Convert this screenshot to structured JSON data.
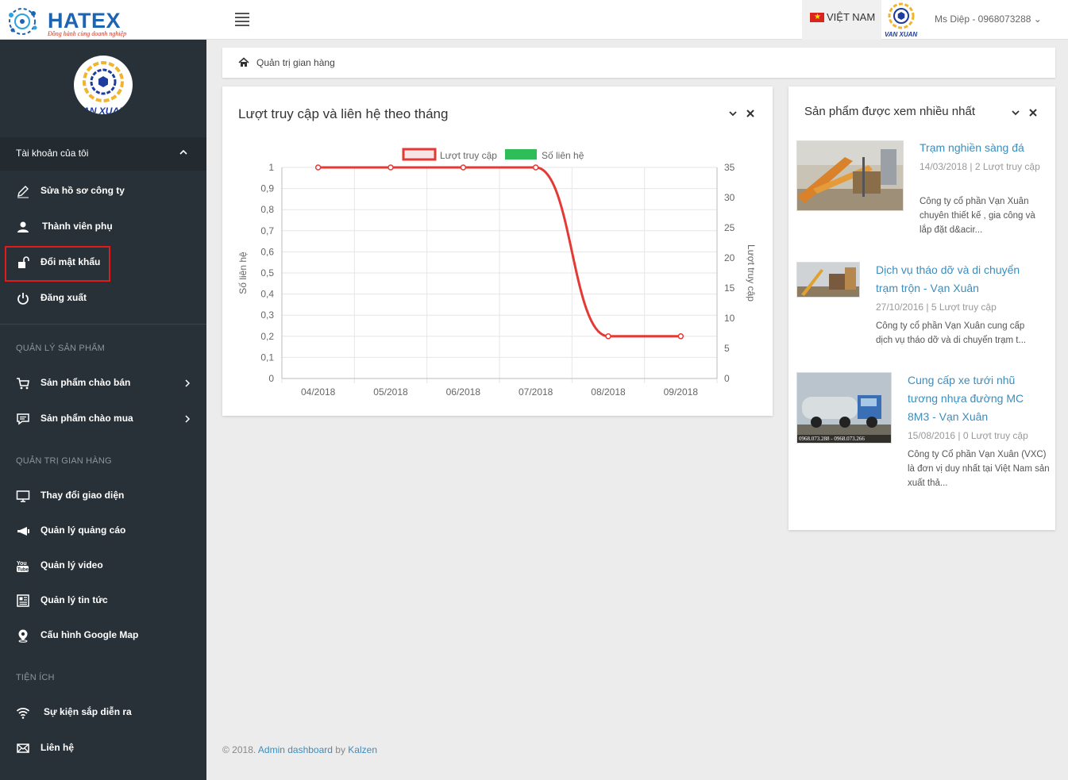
{
  "header": {
    "logo_word": "HATEX",
    "logo_tagline": "Đồng hành cùng doanh nghiệp",
    "language": "VIỆT NAM",
    "brand_mini_text": "VAN XUAN",
    "user": "Ms Diệp - 0968073288 ⌄"
  },
  "sidebar": {
    "avatar_text": "VAN XUAN",
    "account_title": "Tài khoản của tôi",
    "account_items": [
      {
        "label": "Sửa hồ sơ công ty"
      },
      {
        "label": "Thành viên phụ"
      },
      {
        "label": "Đổi mật khẩu"
      },
      {
        "label": "Đăng xuất"
      }
    ],
    "section_products": "QUẢN LÝ SẢN PHẨM",
    "product_items": [
      {
        "label": "Sản phẩm chào bán"
      },
      {
        "label": "Sản phẩm chào mua"
      }
    ],
    "section_store": "QUẢN TRỊ GIAN HÀNG",
    "store_items": [
      {
        "label": "Thay đổi giao diện"
      },
      {
        "label": "Quản lý quảng cáo"
      },
      {
        "label": "Quản lý video"
      },
      {
        "label": "Quản lý tin tức"
      },
      {
        "label": "Cấu hình Google Map"
      }
    ],
    "section_utils": "TIỆN ÍCH",
    "util_items": [
      {
        "label": "Sự kiện sắp diễn ra"
      },
      {
        "label": "Liên hệ"
      }
    ],
    "accent_color": "#e01b1b"
  },
  "breadcrumb": {
    "text": "Quản trị gian hàng"
  },
  "chart_panel": {
    "title": "Lượt truy cập và liên hệ theo tháng"
  },
  "chart_data": {
    "type": "line",
    "categories": [
      "04/2018",
      "05/2018",
      "06/2018",
      "07/2018",
      "08/2018",
      "09/2018"
    ],
    "series": [
      {
        "name": "Lượt truy cập",
        "axis": "right",
        "color": "#e53935",
        "values": [
          35,
          35,
          35,
          35,
          7,
          7
        ]
      },
      {
        "name": "Số liên hệ",
        "axis": "left",
        "color": "#2ebd59",
        "values": []
      }
    ],
    "y_left": {
      "label": "Số liên hệ",
      "min": 0,
      "max": 1,
      "ticks": [
        "0",
        "0,1",
        "0,2",
        "0,3",
        "0,4",
        "0,5",
        "0,6",
        "0,7",
        "0,8",
        "0,9",
        "1"
      ]
    },
    "y_right": {
      "label": "Lượt truy cập",
      "min": 0,
      "max": 35,
      "ticks": [
        "0",
        "5",
        "10",
        "15",
        "20",
        "25",
        "30",
        "35"
      ]
    },
    "legend_position": "top",
    "grid": true
  },
  "popular": {
    "title": "Sản phẩm được xem nhiều nhất",
    "items": [
      {
        "title": "Trạm nghiền sàng đá",
        "meta": "14/03/2018 | 2 Lượt truy cập",
        "desc": "Công ty cổ phần Vạn Xuân chuyên thiết kế , gia công và lắp đặt d&acir..."
      },
      {
        "title": "Dịch vụ tháo dỡ và di chuyển trạm trộn - Vạn Xuân",
        "meta": "27/10/2016 | 5 Lượt truy cập",
        "desc": "Công ty cổ phần Vạn Xuân cung cấp dịch vụ tháo dỡ và di chuyển trạm t..."
      },
      {
        "title": "Cung cấp xe tưới nhũ tương nhựa đường MC 8M3 - Vạn Xuân",
        "meta": "15/08/2016 | 0 Lượt truy cập",
        "desc": "Công ty Cổ phần Vạn Xuân (VXC) là đơn vị duy nhất tại Việt Nam sản xuất thả...",
        "thumb_caption": "0968.073.288 - 0968.073.266"
      }
    ]
  },
  "footer": {
    "prefix": "© 2018. ",
    "link1": "Admin dashboard",
    "by": " by ",
    "link2": "Kalzen"
  }
}
